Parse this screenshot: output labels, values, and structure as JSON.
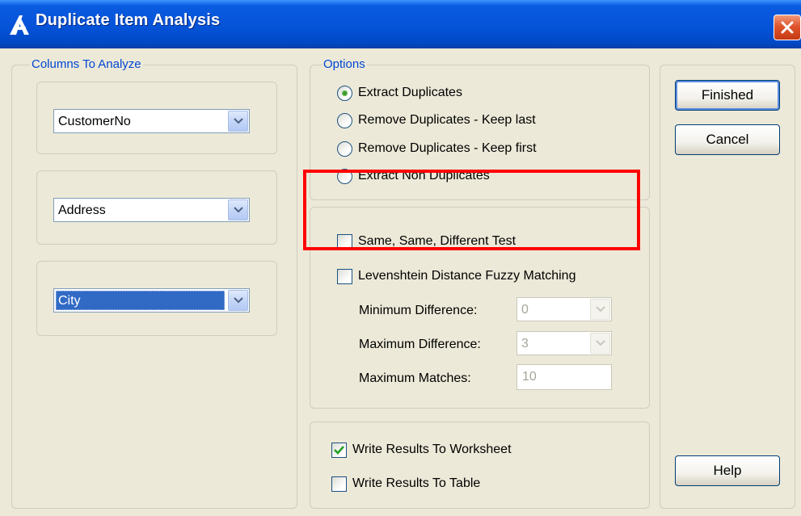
{
  "window": {
    "title": "Duplicate Item Analysis",
    "app_icon": "analysis-logo-icon",
    "close_icon": "close-icon"
  },
  "columns_group": {
    "label": "Columns To Analyze",
    "columns": [
      {
        "value": "CustomerNo",
        "selected": false
      },
      {
        "value": "Address",
        "selected": false
      },
      {
        "value": "City",
        "selected": true
      }
    ]
  },
  "options_group": {
    "label": "Options",
    "radios": [
      {
        "label": "Extract Duplicates",
        "checked": true
      },
      {
        "label": "Remove Duplicates - Keep last",
        "checked": false
      },
      {
        "label": "Remove Duplicates - Keep first",
        "checked": false
      },
      {
        "label": "Extract Non Duplicates",
        "checked": false
      }
    ]
  },
  "matching_group": {
    "checks": [
      {
        "label": "Same, Same, Different Test",
        "checked": false
      },
      {
        "label": "Levenshtein Distance Fuzzy Matching",
        "checked": false
      }
    ],
    "min_difference": {
      "label": "Minimum Difference:",
      "value": "0"
    },
    "max_difference": {
      "label": "Maximum Difference:",
      "value": "3"
    },
    "max_matches": {
      "label": "Maximum Matches:",
      "value": "10"
    }
  },
  "output_group": {
    "checks": [
      {
        "label": "Write Results To Worksheet",
        "checked": true
      },
      {
        "label": "Write Results To Table",
        "checked": false
      }
    ]
  },
  "buttons": {
    "finished": "Finished",
    "cancel": "Cancel",
    "help": "Help"
  },
  "colors": {
    "titlebar": "#0553d8",
    "group_label": "#0046d5",
    "highlight": "#ff0000",
    "selection": "#316ac5"
  }
}
